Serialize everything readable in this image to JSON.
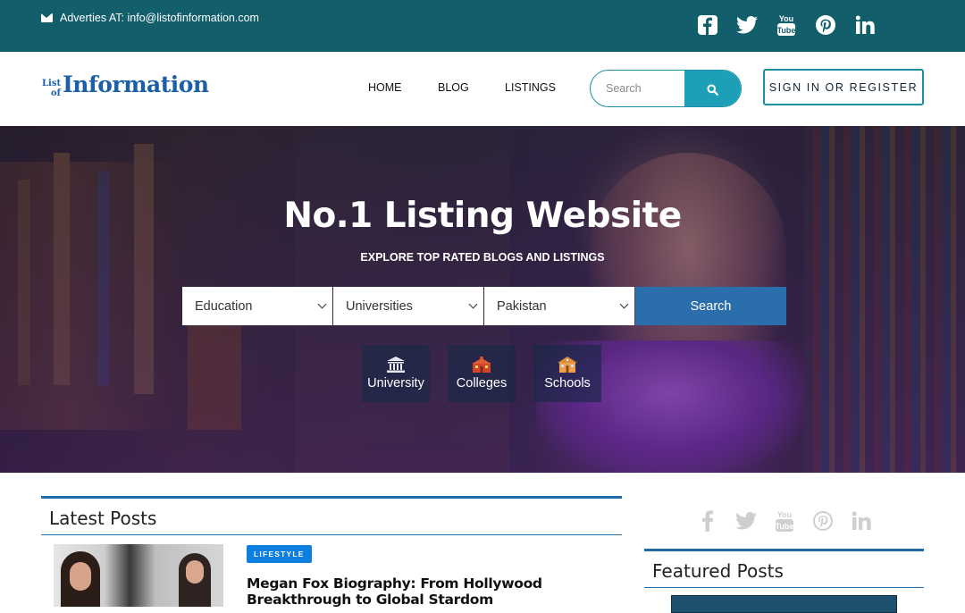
{
  "topbar": {
    "contact_text": "Adverties AT: info@listofinformation.com",
    "social_icons": [
      "facebook-icon",
      "twitter-icon",
      "youtube-icon",
      "pinterest-icon",
      "linkedin-icon"
    ]
  },
  "header": {
    "logo_small_1": "List",
    "logo_small_2": "of",
    "logo_big": "Information",
    "nav": [
      "HOME",
      "BLOG",
      "LISTINGS"
    ],
    "search_placeholder": "Search",
    "signin_label": "SIGN IN OR REGISTER"
  },
  "hero": {
    "title": "No.1 Listing Website",
    "subtitle": "EXPLORE TOP RATED BLOGS AND LISTINGS",
    "selects": [
      "Education",
      "Universities",
      "Pakistan"
    ],
    "search_button": "Search",
    "categories": [
      {
        "label": "University",
        "icon": "university-icon"
      },
      {
        "label": "Colleges",
        "icon": "college-icon"
      },
      {
        "label": "Schools",
        "icon": "school-icon"
      }
    ]
  },
  "latest": {
    "heading": "Latest Posts",
    "post": {
      "category": "LIFESTYLE",
      "title": "Megan Fox Biography: From Hollywood Breakthrough to Global Stardom"
    }
  },
  "sidebar": {
    "featured_heading": "Featured Posts"
  },
  "colors": {
    "topbar": "#125e6b",
    "accent": "#1d9fb7",
    "primary_blue": "#2a6fab",
    "badge": "#0d7fe0"
  }
}
